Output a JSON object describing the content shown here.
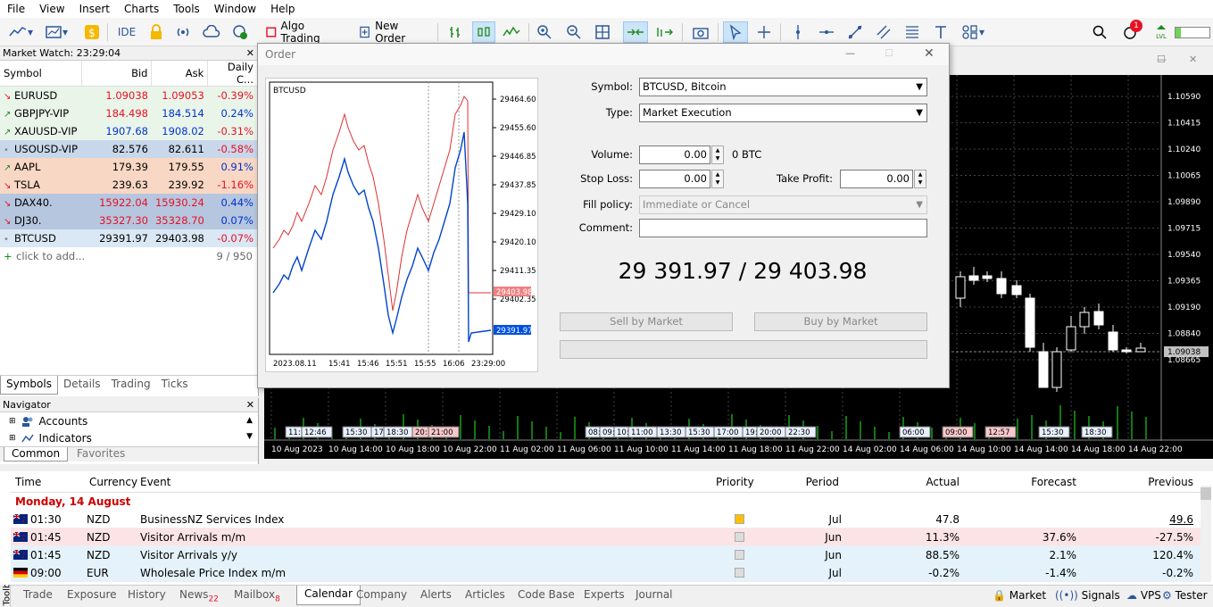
{
  "menu": [
    "File",
    "View",
    "Insert",
    "Charts",
    "Tools",
    "Window",
    "Help"
  ],
  "toolbar": {
    "ide": "IDE",
    "algo_trading": "Algo Trading",
    "new_order": "New Order",
    "notif_count": "1",
    "lvl": "LVL"
  },
  "market_watch": {
    "title": "Market Watch: 23:29:04",
    "columns": [
      "Symbol",
      "Bid",
      "Ask",
      "Daily C..."
    ],
    "rows": [
      {
        "symbol": "EURUSD",
        "bid": "1.09038",
        "ask": "1.09053",
        "change": "-0.39%"
      },
      {
        "symbol": "GBPJPY-VIP",
        "bid": "184.498",
        "ask": "184.514",
        "change": "0.24%"
      },
      {
        "symbol": "XAUUSD-VIP",
        "bid": "1907.68",
        "ask": "1908.02",
        "change": "-0.31%"
      },
      {
        "symbol": "USOUSD-VIP",
        "bid": "82.576",
        "ask": "82.611",
        "change": "-0.58%"
      },
      {
        "symbol": "AAPL",
        "bid": "179.39",
        "ask": "179.55",
        "change": "0.91%"
      },
      {
        "symbol": "TSLA",
        "bid": "239.63",
        "ask": "239.92",
        "change": "-1.16%"
      },
      {
        "symbol": "DAX40.",
        "bid": "15922.04",
        "ask": "15930.24",
        "change": "0.44%"
      },
      {
        "symbol": "DJ30.",
        "bid": "35327.30",
        "ask": "35328.70",
        "change": "0.07%"
      },
      {
        "symbol": "BTCUSD",
        "bid": "29391.97",
        "ask": "29403.98",
        "change": "-0.07%"
      }
    ],
    "add_text": "click to add...",
    "count": "9 / 950",
    "tabs": [
      "Symbols",
      "Details",
      "Trading",
      "Ticks"
    ]
  },
  "navigator": {
    "title": "Navigator",
    "items": [
      "Accounts",
      "Indicators"
    ],
    "tabs": [
      "Common",
      "Favorites"
    ]
  },
  "order": {
    "title": "Order",
    "symbol_label": "Symbol:",
    "symbol_value": "BTCUSD, Bitcoin",
    "type_label": "Type:",
    "type_value": "Market Execution",
    "volume_label": "Volume:",
    "volume_value": "0.00",
    "volume_unit": "0 BTC",
    "sl_label": "Stop Loss:",
    "sl_value": "0.00",
    "tp_label": "Take Profit:",
    "tp_value": "0.00",
    "fill_label": "Fill policy:",
    "fill_value": "Immediate or Cancel",
    "comment_label": "Comment:",
    "price_display": "29 391.97 / 29 403.98",
    "sell_label": "Sell by Market",
    "buy_label": "Buy by Market",
    "mini_chart": {
      "symbol": "BTCUSD",
      "y_ticks": [
        "29464.60",
        "29455.60",
        "29446.85",
        "29437.85",
        "29429.10",
        "29420.10",
        "29411.35",
        "29402.35"
      ],
      "x_ticks": [
        "2023.08.11",
        "15:41",
        "15:46",
        "15:51",
        "15:55",
        "16:06",
        "23:29:00"
      ],
      "ask_label": "29403.98",
      "bid_label": "29391.97"
    }
  },
  "chart": {
    "y_ticks": [
      "1.10590",
      "1.10415",
      "1.10240",
      "1.10065",
      "1.09890",
      "1.09715",
      "1.09540",
      "1.09365",
      "1.09190",
      "1.09038",
      "1.08840",
      "1.08665"
    ],
    "current_price": "1.09038",
    "x_ticks": [
      "10 Aug 2023",
      "10 Aug 14:00",
      "10 Aug 18:00",
      "10 Aug 22:00",
      "11 Aug 02:00",
      "11 Aug 06:00",
      "11 Aug 10:00",
      "11 Aug 14:00",
      "11 Aug 18:00",
      "11 Aug 22:00",
      "14 Aug 02:00",
      "14 Aug 06:00",
      "14 Aug 10:00",
      "14 Aug 14:00",
      "14 Aug 18:00",
      "14 Aug 22:00"
    ],
    "event_tags": [
      "11:",
      "12:46",
      "15:30",
      "17:",
      "18:30",
      "20:",
      "21:00",
      "08:",
      "09:",
      "10:",
      "11:00",
      "13:30",
      "15:30",
      "17:00",
      "19:",
      "20:00",
      "22:30",
      "06:00",
      "09:00",
      "12:57",
      "15:30",
      "18:30"
    ]
  },
  "calendar": {
    "columns": [
      "Time",
      "Currency",
      "Event",
      "Priority",
      "Period",
      "Actual",
      "Forecast",
      "Previous"
    ],
    "day": "Monday, 14 August",
    "rows": [
      {
        "time": "01:30",
        "currency": "NZD",
        "event": "BusinessNZ Services Index",
        "period": "Jul",
        "actual": "47.8",
        "forecast": "",
        "previous": "49.6"
      },
      {
        "time": "01:45",
        "currency": "NZD",
        "event": "Visitor Arrivals m/m",
        "period": "Jun",
        "actual": "11.3%",
        "forecast": "37.6%",
        "previous": "-27.5%"
      },
      {
        "time": "01:45",
        "currency": "NZD",
        "event": "Visitor Arrivals y/y",
        "period": "Jun",
        "actual": "88.5%",
        "forecast": "2.1%",
        "previous": "120.4%"
      },
      {
        "time": "09:00",
        "currency": "EUR",
        "event": "Wholesale Price Index m/m",
        "period": "Jul",
        "actual": "-0.2%",
        "forecast": "-1.4%",
        "previous": "-0.2%"
      }
    ]
  },
  "bottom_tabs": [
    {
      "label": "Trade",
      "badge": ""
    },
    {
      "label": "Exposure",
      "badge": ""
    },
    {
      "label": "History",
      "badge": ""
    },
    {
      "label": "News",
      "badge": "22"
    },
    {
      "label": "Mailbox",
      "badge": "8"
    },
    {
      "label": "Calendar",
      "badge": ""
    },
    {
      "label": "Company",
      "badge": ""
    },
    {
      "label": "Alerts",
      "badge": ""
    },
    {
      "label": "Articles",
      "badge": ""
    },
    {
      "label": "Code Base",
      "badge": ""
    },
    {
      "label": "Experts",
      "badge": ""
    },
    {
      "label": "Journal",
      "badge": ""
    }
  ],
  "status_tools": [
    "Market",
    "Signals",
    "VPS",
    "Tester"
  ],
  "toolbox_label": "Toolbox",
  "colors": {
    "up": "#1e8c1e",
    "down": "#e81123",
    "blue": "#0033cc",
    "highlight": "#cce4f7"
  }
}
